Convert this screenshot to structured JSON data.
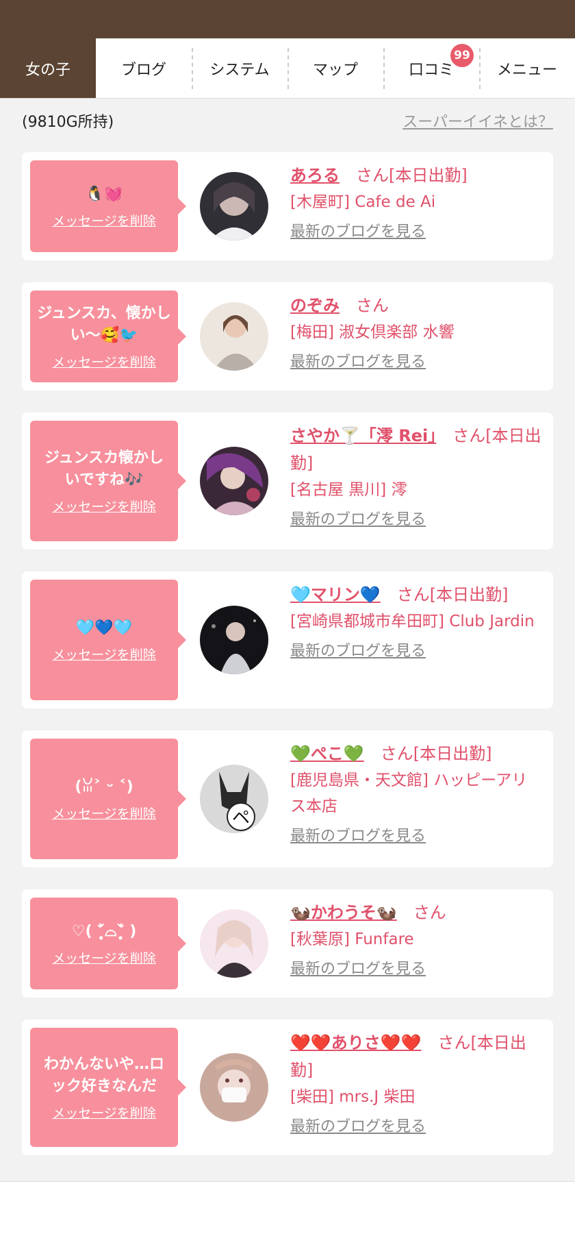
{
  "nav": {
    "tabs": [
      {
        "label": "女の子"
      },
      {
        "label": "ブログ"
      },
      {
        "label": "システム"
      },
      {
        "label": "マップ"
      },
      {
        "label": "口コミ"
      },
      {
        "label": "メニュー"
      }
    ],
    "kuchikomi_badge": "99"
  },
  "info": {
    "points": "(9810G所持)",
    "super_link": "スーパーイイネとは？"
  },
  "cards": [
    {
      "message": "🐧💓",
      "delete": "メッセージを削除",
      "name": "あろる",
      "suffix": "さん[本日出勤]",
      "shop": "[木屋町] Cafe de Ai",
      "blog": "最新のブログを見る"
    },
    {
      "message": "ジュンスカ、懐かしい〜🥰🐦",
      "delete": "メッセージを削除",
      "name": "のぞみ",
      "suffix": "さん",
      "shop": "[梅田] 淑女倶楽部 水響",
      "blog": "最新のブログを見る"
    },
    {
      "message": "ジュンスカ懐かしいですね🎶",
      "delete": "メッセージを削除",
      "name": "さやか🍸「澪 Rei」",
      "suffix": "さん[本日出勤]",
      "shop": "[名古屋 黒川] 澪",
      "blog": "最新のブログを見る"
    },
    {
      "message": "🩵💙🩵",
      "delete": "メッセージを削除",
      "name": "🩵マリン💙",
      "suffix": "さん[本日出勤]",
      "shop": "[宮崎県都城市牟田町] Club Jardin",
      "blog": "最新のブログを見る"
    },
    {
      "message": "(ꈍ˃ ᵕ ˂)",
      "delete": "メッセージを削除",
      "name": "💚ぺこ💚",
      "suffix": "さん[本日出勤]",
      "shop": "[鹿児島県・天文館] ハッピーアリス本店",
      "blog": "最新のブログを見る"
    },
    {
      "message": "♡( ˃̣̣̥᷄⌓˂̣̣̥᷅ )",
      "delete": "メッセージを削除",
      "name": "🦦かわうそ🦦",
      "suffix": "さん",
      "shop": "[秋葉原] Funfare",
      "blog": "最新のブログを見る"
    },
    {
      "message": "わかんないや…ロック好きなんだ",
      "delete": "メッセージを削除",
      "name": "❤️❤️ありさ❤️❤️",
      "suffix": "さん[本日出勤]",
      "shop": "[柴田] mrs.J 柴田",
      "blog": "最新のブログを見る"
    }
  ],
  "colors": {
    "header_brown": "#5b4433",
    "message_pink": "#f7909c",
    "name_pink": "#e0506a",
    "badge_red": "#e85a6a"
  }
}
